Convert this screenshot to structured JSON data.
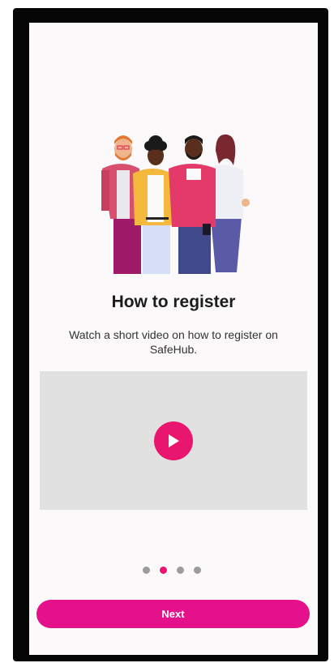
{
  "onboarding": {
    "title": "How to register",
    "subtitle": "Watch a short video on how to register on SafeHub.",
    "page_indicator": {
      "total": 4,
      "current": 2
    },
    "next_label": "Next"
  },
  "video": {
    "play_icon": "play-icon"
  },
  "colors": {
    "accent": "#e8166e",
    "next_button": "#e5118a",
    "video_placeholder": "#e1e1e1",
    "screen_background": "#fbf9fa",
    "inactive_dot": "#9c9c9c"
  }
}
